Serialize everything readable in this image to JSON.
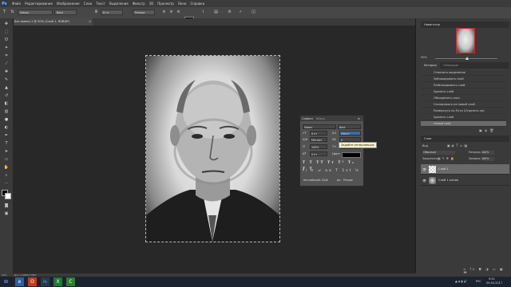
{
  "app": {
    "logo": "Ps"
  },
  "menu": [
    "Файл",
    "Редактирование",
    "Изображение",
    "Слои",
    "Текст",
    "Выделение",
    "Фильтр",
    "3D",
    "Просмотр",
    "Окно",
    "Справка"
  ],
  "options": {
    "font_family": "Sabon",
    "font_style": "Bold",
    "font_size": "8 пт",
    "aa": "Резкое"
  },
  "document": {
    "tab_title": "Без имени-1 @ 50% (Слой 1, RGB/8*)",
    "zoom_status": "Док: 2,98M/2,98M",
    "zoom": "50%"
  },
  "character_panel": {
    "tabs": [
      "Символ",
      "Абзац"
    ],
    "font_family": "Sabon",
    "font_style": "Bold",
    "size": "8 пт",
    "leading": "(Авто)",
    "tracking": "0",
    "kerning": "Метрич.",
    "scale_v": "100%",
    "scale_h": "100%",
    "baseline": "0 пт",
    "color_label": "Цвет:",
    "lang": "Английский: США",
    "aa_label": "аа",
    "aa_value": "Резкое",
    "tooltip": "Задайте интерлиньяж"
  },
  "navigator": {
    "title": "Навигатор",
    "zoom": "50%"
  },
  "history": {
    "tabs": [
      "История",
      "Операции"
    ],
    "items": [
      "Отменить выделение",
      "Заблокировать слой",
      "Разблокировать слой",
      "Удалить слой",
      "Объединить слои",
      "Скопировать на новый слой",
      "Развернуть по Пути (Отразить ни)",
      "Удалить слой",
      "Новый слой"
    ]
  },
  "layers": {
    "title": "Слои",
    "kind": "Вид",
    "blend": "Обычные",
    "opacity_label": "Непрозр.:",
    "opacity": "100%",
    "lock_label": "Закрепить:",
    "fill_label": "Заливка:",
    "fill": "100%",
    "items": [
      "Слой 1",
      "Слой 1 копия"
    ]
  },
  "taskbar": {
    "lang": "РУС",
    "time": "9:51",
    "date": "09.04.2017"
  },
  "colors": {
    "accent": "#7fb8ff",
    "selection": "#6a6a6a"
  }
}
